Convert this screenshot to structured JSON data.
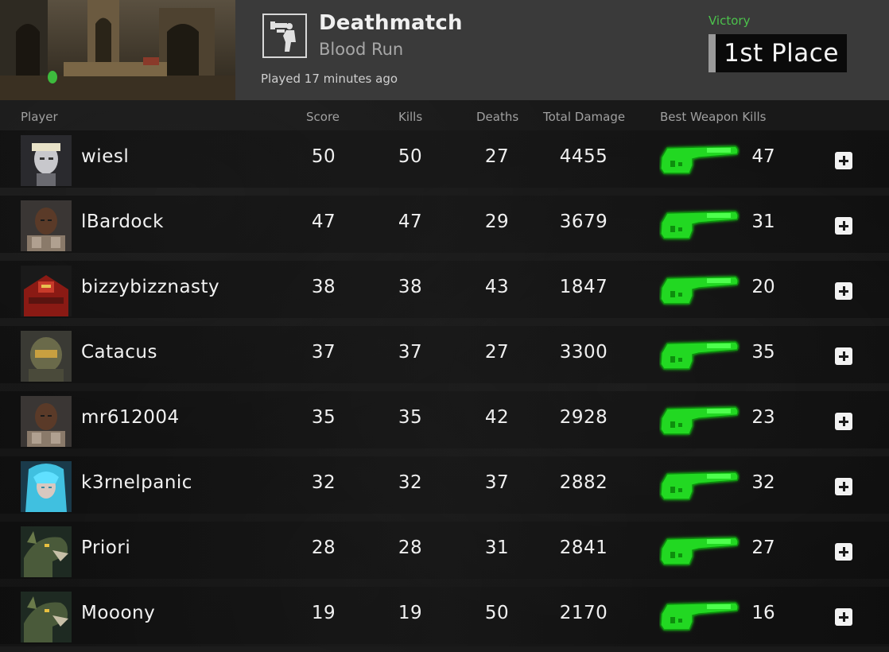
{
  "match": {
    "mode": "Deathmatch",
    "map": "Blood Run",
    "played": "Played 17 minutes ago",
    "result": "Victory",
    "placement": "1st Place",
    "icons": {
      "mode": "deathmatch-icon",
      "map": "map-thumbnail"
    }
  },
  "columns": {
    "player": "Player",
    "score": "Score",
    "kills": "Kills",
    "deaths": "Deaths",
    "damage": "Total Damage",
    "weapon": "Best Weapon Kills"
  },
  "colors": {
    "victory": "#4cc24c",
    "weapon_glow": "#3dff3d",
    "header_bg": "#3a3a3a"
  },
  "players": [
    {
      "name": "wiesl",
      "score": "50",
      "kills": "50",
      "deaths": "27",
      "damage": "4455",
      "weapon_kills": "47",
      "avatar": "ranger-avatar",
      "weapon_icon": "rocket-launcher-icon"
    },
    {
      "name": "lBardock",
      "score": "47",
      "kills": "47",
      "deaths": "29",
      "damage": "3679",
      "weapon_kills": "31",
      "avatar": "bj-avatar",
      "weapon_icon": "rocket-launcher-icon"
    },
    {
      "name": "bizzybizznasty",
      "score": "38",
      "kills": "38",
      "deaths": "43",
      "damage": "1847",
      "weapon_kills": "20",
      "avatar": "scalebearer-avatar",
      "weapon_icon": "rocket-launcher-icon"
    },
    {
      "name": "Catacus",
      "score": "37",
      "kills": "37",
      "deaths": "27",
      "damage": "3300",
      "weapon_kills": "35",
      "avatar": "doom-avatar",
      "weapon_icon": "rocket-launcher-icon"
    },
    {
      "name": "mr612004",
      "score": "35",
      "kills": "35",
      "deaths": "42",
      "damage": "2928",
      "weapon_kills": "23",
      "avatar": "bj-avatar",
      "weapon_icon": "rocket-launcher-icon"
    },
    {
      "name": "k3rnelpanic",
      "score": "32",
      "kills": "32",
      "deaths": "37",
      "damage": "2882",
      "weapon_kills": "32",
      "avatar": "galena-avatar",
      "weapon_icon": "rocket-launcher-icon"
    },
    {
      "name": "Priori",
      "score": "28",
      "kills": "28",
      "deaths": "31",
      "damage": "2841",
      "weapon_kills": "27",
      "avatar": "sorlag-avatar",
      "weapon_icon": "rocket-launcher-icon"
    },
    {
      "name": "Mooony",
      "score": "19",
      "kills": "19",
      "deaths": "50",
      "damage": "2170",
      "weapon_kills": "16",
      "avatar": "sorlag-avatar",
      "weapon_icon": "rocket-launcher-icon"
    }
  ]
}
